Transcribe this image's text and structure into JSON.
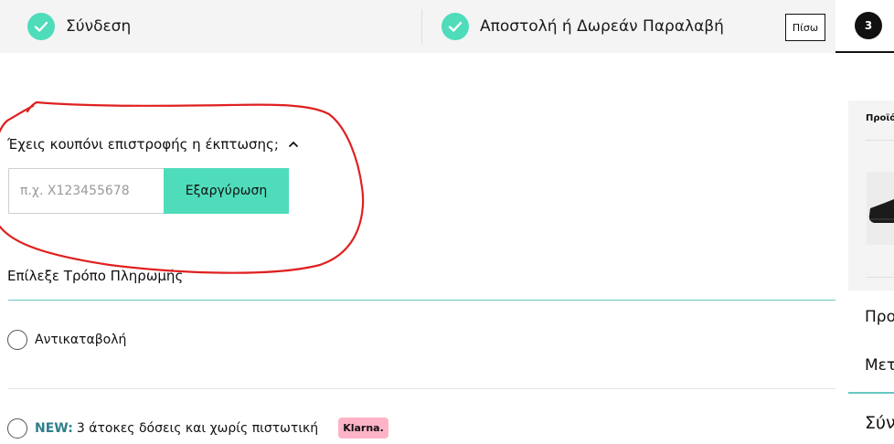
{
  "steps": {
    "step1_label": "Σύνδεση",
    "step2_label": "Αποστολή ή Δωρεάν Παραλαβή",
    "back_label": "Πίσω",
    "step3_number": "3"
  },
  "coupon": {
    "question": "Έχεις κουπόνι επιστροφής η έκπτωσης;",
    "input_placeholder": "π.χ. Χ123455678",
    "redeem_label": "Εξαργύρωση"
  },
  "payment": {
    "title": "Επίλεξε Τρόπο Πληρωμής",
    "options": [
      {
        "label": "Αντικαταβολή"
      },
      {
        "new_tag": "NEW:",
        "label": "3 άτοκες δόσεις και χωρίς πιστωτική",
        "badge": "Klarna."
      }
    ]
  },
  "summary": {
    "header_partial": "Προϊό",
    "row1_partial": "Προ",
    "row2_partial": "Μετ",
    "row3_partial": "Σύν"
  },
  "colors": {
    "accent": "#4fdcbb",
    "divider_accent": "#67c9c1",
    "klarna_pink": "#ffb3c7",
    "annotation_red": "#e02020"
  },
  "icons": [
    "check-icon",
    "chevron-up-icon",
    "shoe-image"
  ]
}
